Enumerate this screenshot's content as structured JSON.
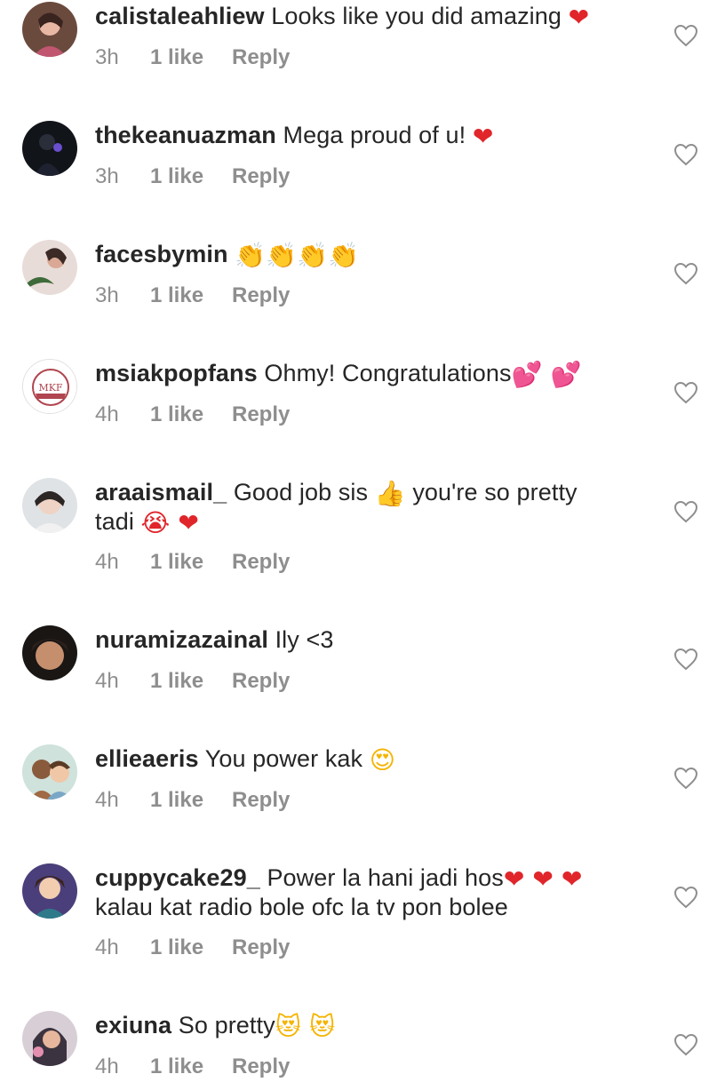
{
  "colors": {
    "text": "#262626",
    "meta": "#8e8e8e",
    "heart_emoji": "#e0262b",
    "pink_emoji": "#ff4f9a",
    "yellow_emoji": "#f5b400"
  },
  "comments": [
    {
      "username": "calistaleahliew",
      "text": "Looks like you did amazing",
      "emoji": "❤",
      "emoji_icon": "red-heart-emoji",
      "time": "3h",
      "likes": "1 like",
      "reply": "Reply"
    },
    {
      "username": "thekeanuazman",
      "text": "Mega proud of u!",
      "emoji": "❤",
      "emoji_icon": "red-heart-emoji",
      "time": "3h",
      "likes": "1 like",
      "reply": "Reply"
    },
    {
      "username": "facesbymin",
      "text": "",
      "emoji": "👏👏👏👏",
      "emoji_icon": "clapping-hands-emoji",
      "time": "3h",
      "likes": "1 like",
      "reply": "Reply"
    },
    {
      "username": "msiakpopfans",
      "text": "Ohmy! Congratulations",
      "emoji": "💕 💕",
      "emoji_icon": "two-hearts-emoji",
      "time": "4h",
      "likes": "1 like",
      "reply": "Reply",
      "avatar_text": "MKF"
    },
    {
      "username": "araaismail_",
      "text": "Good job sis",
      "emoji": "👍",
      "emoji_icon": "thumbs-up-emoji",
      "text2": "you're so pretty",
      "line2": "tadi",
      "line2_emoji": "😭 ❤",
      "time": "4h",
      "likes": "1 like",
      "reply": "Reply"
    },
    {
      "username": "nuramizazainal",
      "text": "Ily <3",
      "time": "4h",
      "likes": "1 like",
      "reply": "Reply"
    },
    {
      "username": "ellieaeris",
      "text": "You power kak",
      "emoji": "😍",
      "emoji_icon": "heart-eyes-emoji",
      "time": "4h",
      "likes": "1 like",
      "reply": "Reply"
    },
    {
      "username": "cuppycake29_",
      "text": "Power la hani jadi hos",
      "emoji": "❤ ❤ ❤",
      "emoji_icon": "red-heart-emoji",
      "line2": "kalau kat radio bole ofc la tv pon bolee",
      "time": "4h",
      "likes": "1 like",
      "reply": "Reply"
    },
    {
      "username": "exiuna",
      "text": "So pretty",
      "emoji": "😻 😻",
      "emoji_icon": "heart-eyes-cat-emoji",
      "time": "4h",
      "likes": "1 like",
      "reply": "Reply"
    }
  ]
}
